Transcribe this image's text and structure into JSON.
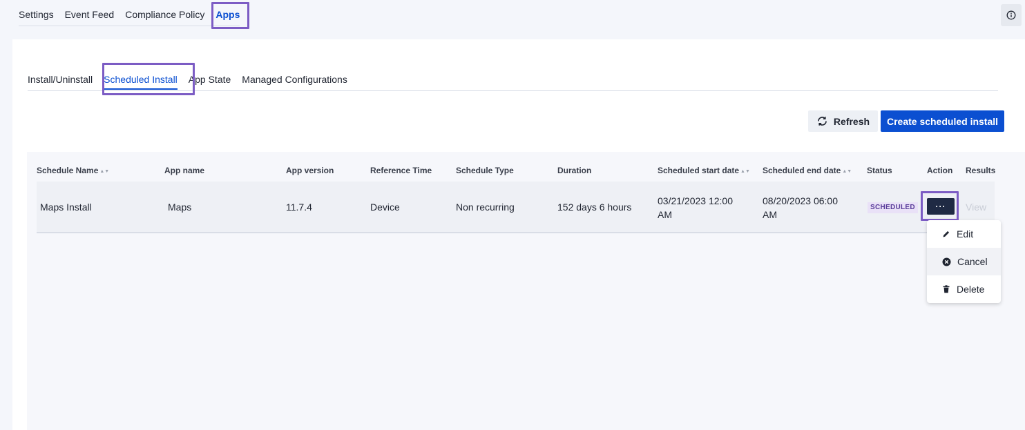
{
  "top_tabs": [
    "Settings",
    "Event Feed",
    "Compliance Policy",
    "Apps"
  ],
  "sub_tabs": [
    "Install/Uninstall",
    "Scheduled Install",
    "App State",
    "Managed Configurations"
  ],
  "toolbar": {
    "refresh_label": "Refresh",
    "create_label": "Create scheduled install"
  },
  "table": {
    "columns": [
      "Schedule Name",
      "App name",
      "App version",
      "Reference Time",
      "Schedule Type",
      "Duration",
      "Scheduled start date",
      "Scheduled end date",
      "Status",
      "Action",
      "Results"
    ],
    "rows": [
      {
        "schedule_name": "Maps Install",
        "app_name": "Maps",
        "app_version": "11.7.4",
        "reference_time": "Device",
        "schedule_type": "Non recurring",
        "duration": "152 days 6 hours",
        "start_line1": "03/21/2023 12:00",
        "start_line2": "AM",
        "end_line1": "08/20/2023 06:00",
        "end_line2": "AM",
        "status": "SCHEDULED",
        "action": "···",
        "results": "View"
      }
    ]
  },
  "action_menu": {
    "items": [
      {
        "label": "Edit",
        "icon": "pencil-icon"
      },
      {
        "label": "Cancel",
        "icon": "close-circle-icon"
      },
      {
        "label": "Delete",
        "icon": "trash-icon"
      }
    ]
  },
  "colors": {
    "accent": "#0b4fd1",
    "highlight": "#7c5cc4",
    "status_badge_bg": "#e9e1f7",
    "status_badge_text": "#5a3d9a",
    "action_button": "#1f2a44"
  }
}
